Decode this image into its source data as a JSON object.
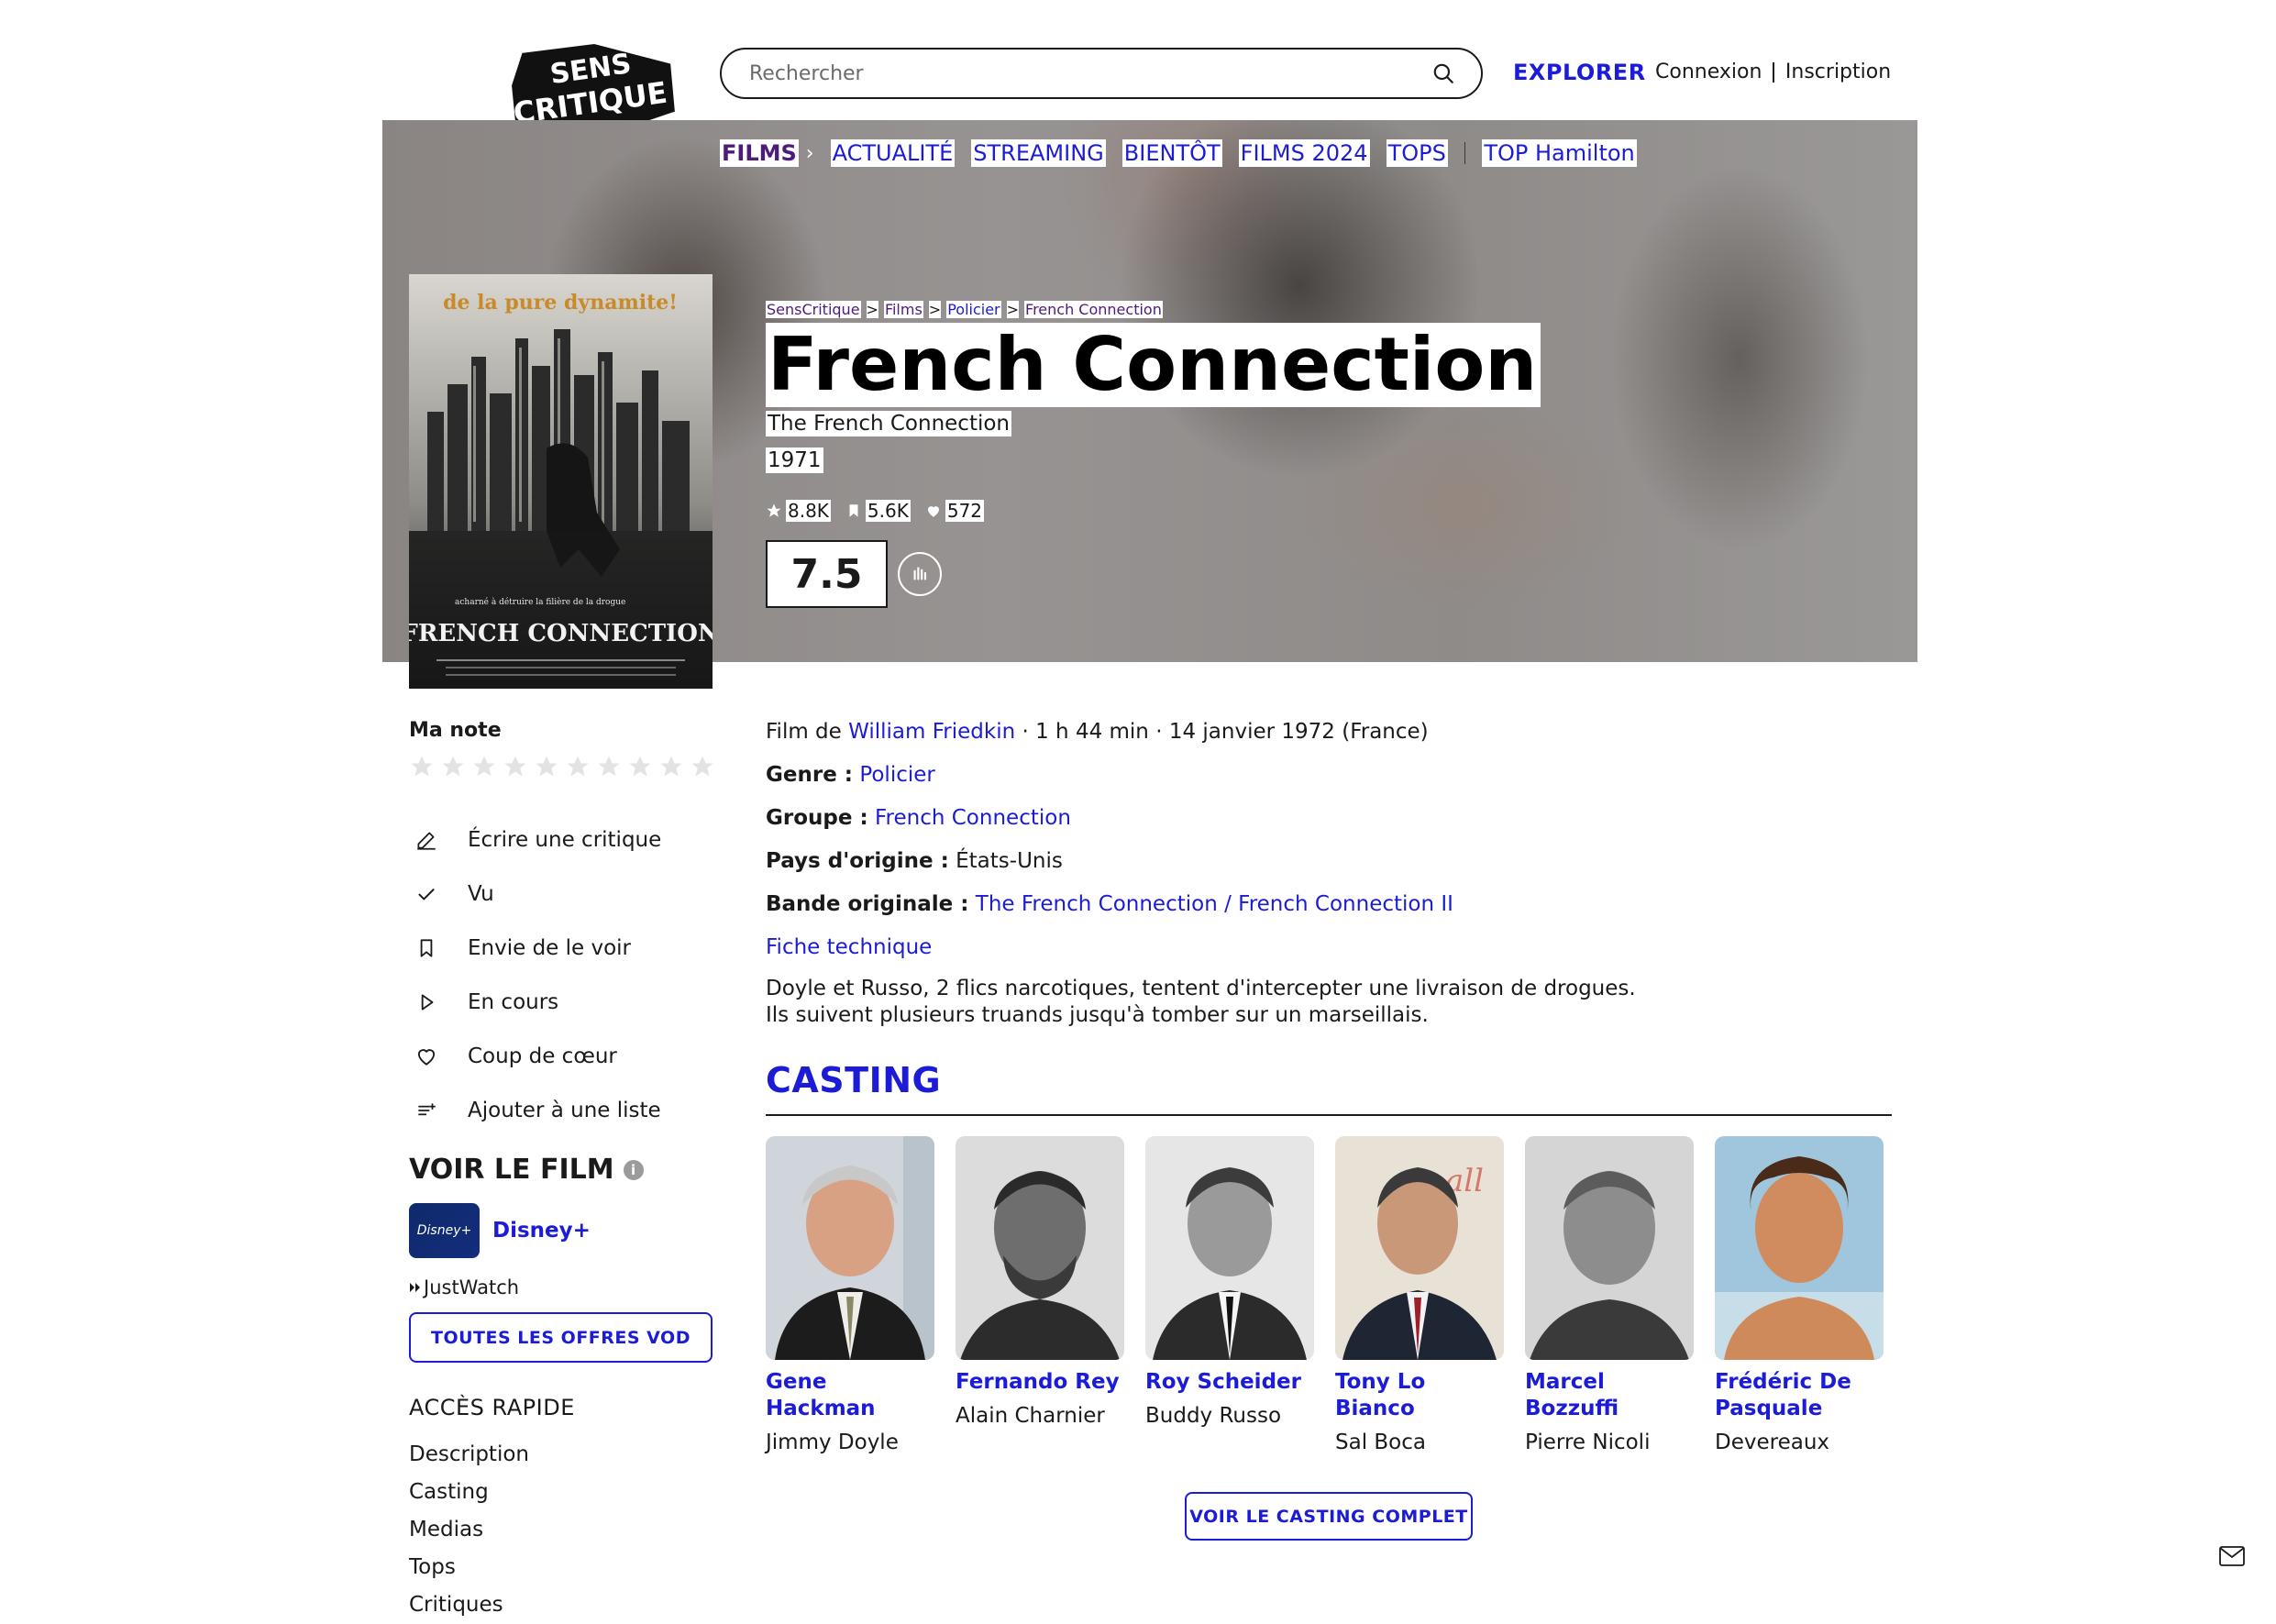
{
  "header": {
    "logo_text_1": "SENS",
    "logo_text_2": "CRITIQUE",
    "search_placeholder": "Rechercher",
    "explore_label": "EXPLORER",
    "login_label": "Connexion",
    "signup_label": "Inscription"
  },
  "nav": {
    "films": "FILMS",
    "items": [
      "ACTUALITÉ",
      "STREAMING",
      "BIENTÔT",
      "FILMS 2024",
      "TOPS"
    ],
    "top": "TOP Hamilton"
  },
  "breadcrumb": [
    "SensCritique",
    "Films",
    "Policier",
    "French Connection"
  ],
  "film": {
    "title": "French Connection",
    "original_title": "The French Connection",
    "year": "1971",
    "ratings_count": "8.8K",
    "wishlist_count": "5.6K",
    "favorites_count": "572",
    "score": "7.5",
    "poster": {
      "tagline": "de la pure dynamite!",
      "side_text": "acharné à détruire la filière de la drogue",
      "title": "FRENCH CONNECTION"
    }
  },
  "my_rating": {
    "label": "Ma note",
    "stars": 10,
    "rating": 0
  },
  "actions": [
    {
      "icon": "pencil-icon",
      "label": "Écrire une critique"
    },
    {
      "icon": "check-icon",
      "label": "Vu"
    },
    {
      "icon": "bookmark-icon",
      "label": "Envie de le voir"
    },
    {
      "icon": "play-icon",
      "label": "En cours"
    },
    {
      "icon": "heart-icon",
      "label": "Coup de cœur"
    },
    {
      "icon": "list-add-icon",
      "label": "Ajouter à une liste"
    }
  ],
  "watch": {
    "title": "VOIR LE FILM",
    "provider": "Disney+",
    "provider_tile": "Disney+",
    "justwatch": "JustWatch",
    "vod_button": "TOUTES LES OFFRES VOD"
  },
  "quick_access": {
    "title": "ACCÈS RAPIDE",
    "items": [
      "Description",
      "Casting",
      "Medias",
      "Tops",
      "Critiques"
    ]
  },
  "details": {
    "film_by_prefix": "Film de",
    "director": "William Friedkin",
    "duration_date": "· 1 h 44 min · 14 janvier 1972 (France)",
    "genre_label": "Genre :",
    "genre": "Policier",
    "group_label": "Groupe :",
    "group": "French Connection",
    "country_label": "Pays d'origine :",
    "country": "États-Unis",
    "soundtrack_label": "Bande originale :",
    "soundtrack": "The French Connection / French Connection II",
    "tech_sheet": "Fiche technique",
    "synopsis": "Doyle et Russo, 2 flics narcotiques, tentent d'intercepter une livraison de drogues. Ils suivent plusieurs truands jusqu'à tomber sur un marseillais."
  },
  "casting": {
    "title": "CASTING",
    "full_button": "VOIR LE CASTING COMPLET",
    "actors": [
      {
        "name": "Gene Hackman",
        "role": "Jimmy Doyle"
      },
      {
        "name": "Fernando Rey",
        "role": "Alain Charnier"
      },
      {
        "name": "Roy Scheider",
        "role": "Buddy Russo"
      },
      {
        "name": "Tony Lo Bianco",
        "role": "Sal Boca"
      },
      {
        "name": "Marcel Bozzuffi",
        "role": "Pierre Nicoli"
      },
      {
        "name": "Frédéric De Pasquale",
        "role": "Devereaux"
      }
    ]
  },
  "colors": {
    "link": "#1c1cd6",
    "films_nav": "#4d1b7a",
    "text": "#1a1a1a"
  }
}
